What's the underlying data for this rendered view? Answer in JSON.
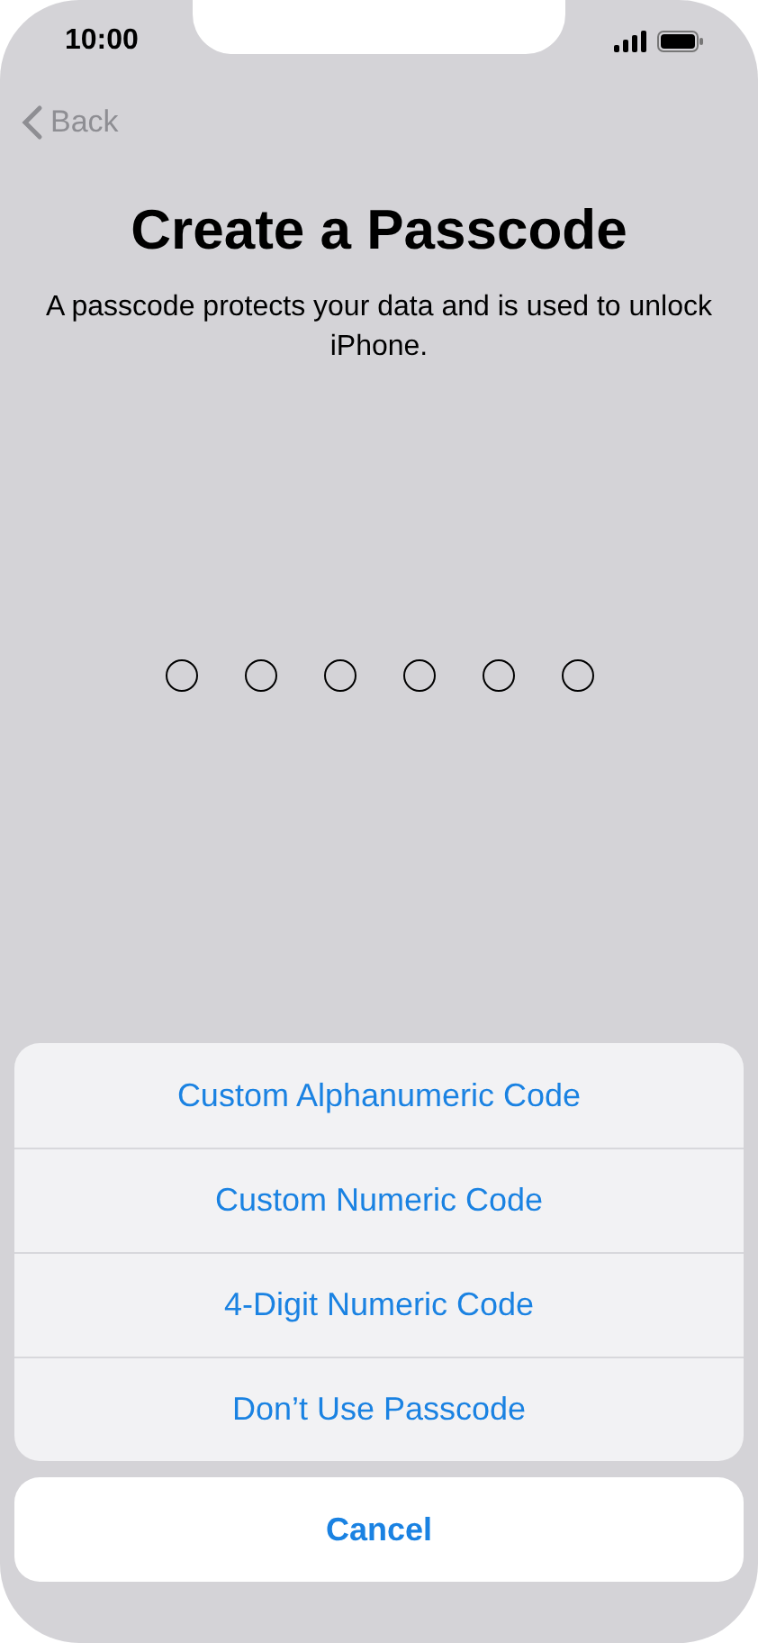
{
  "status_bar": {
    "time": "10:00"
  },
  "nav": {
    "back": "Back"
  },
  "title": "Create a Passcode",
  "description": "A passcode protects your data and is used to unlock iPhone.",
  "passcode_dots": [
    {
      "filled": false
    },
    {
      "filled": false
    },
    {
      "filled": false
    },
    {
      "filled": false
    },
    {
      "filled": false
    },
    {
      "filled": false
    }
  ],
  "action_sheet": {
    "options": [
      "Custom Alphanumeric Code",
      "Custom Numeric Code",
      "4-Digit Numeric Code",
      "Don’t Use Passcode"
    ],
    "cancel": "Cancel"
  }
}
